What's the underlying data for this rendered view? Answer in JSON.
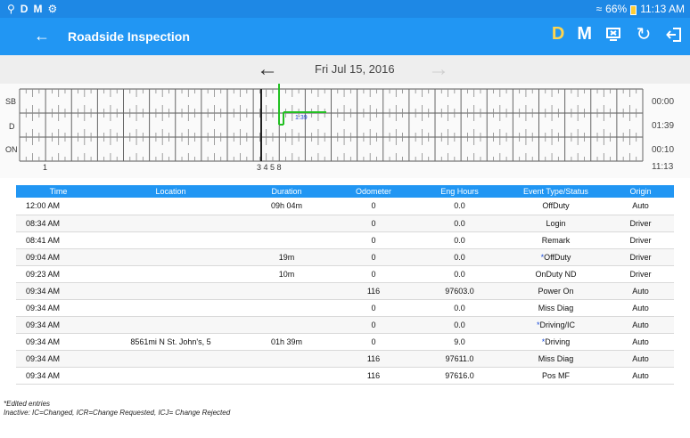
{
  "status_bar": {
    "left_icons": [
      "location-icon",
      "D",
      "M",
      "usb-icon"
    ],
    "battery": "66%",
    "time": "11:13 AM"
  },
  "app_bar": {
    "title": "Roadside Inspection",
    "actions": [
      {
        "label": "D",
        "color": "#ffd54f"
      },
      {
        "label": "M",
        "color": "#ffffff"
      }
    ]
  },
  "date_nav": {
    "date": "Fri Jul 15, 2016"
  },
  "graph": {
    "rows": [
      "SB",
      "D",
      "ON"
    ],
    "totals": [
      "00:00",
      "01:39",
      "00:10"
    ],
    "grand_total": "11:13",
    "start_hour_label": "1",
    "event_marker_label": "3 4 5 8",
    "segment_label": "1:39"
  },
  "table": {
    "headers": [
      "Time",
      "Location",
      "Duration",
      "Odometer",
      "Eng Hours",
      "Event Type/Status",
      "Origin"
    ],
    "rows": [
      {
        "time": "12:00 AM",
        "location": "",
        "duration": "09h 04m",
        "odometer": "0",
        "eng_hours": "0.0",
        "star": "",
        "event": "OffDuty",
        "origin": "Auto"
      },
      {
        "time": "08:34 AM",
        "location": "",
        "duration": "",
        "odometer": "0",
        "eng_hours": "0.0",
        "star": "",
        "event": "Login",
        "origin": "Driver"
      },
      {
        "time": "08:41 AM",
        "location": "",
        "duration": "",
        "odometer": "0",
        "eng_hours": "0.0",
        "star": "",
        "event": "Remark",
        "origin": "Driver"
      },
      {
        "time": "09:04 AM",
        "location": "",
        "duration": "19m",
        "odometer": "0",
        "eng_hours": "0.0",
        "star": "*",
        "event": "OffDuty",
        "origin": "Driver"
      },
      {
        "time": "09:23 AM",
        "location": "",
        "duration": "10m",
        "odometer": "0",
        "eng_hours": "0.0",
        "star": "",
        "event": "OnDuty ND",
        "origin": "Driver"
      },
      {
        "time": "09:34 AM",
        "location": "",
        "duration": "",
        "odometer": "116",
        "eng_hours": "97603.0",
        "star": "",
        "event": "Power On",
        "origin": "Auto"
      },
      {
        "time": "09:34 AM",
        "location": "",
        "duration": "",
        "odometer": "0",
        "eng_hours": "0.0",
        "star": "",
        "event": "Miss Diag",
        "origin": "Auto"
      },
      {
        "time": "09:34 AM",
        "location": "",
        "duration": "",
        "odometer": "0",
        "eng_hours": "0.0",
        "star": "*",
        "event": "Driving/IC",
        "origin": "Auto"
      },
      {
        "time": "09:34 AM",
        "location": "8561mi N St. John's, 5",
        "duration": "01h 39m",
        "odometer": "0",
        "eng_hours": "9.0",
        "star": "*",
        "event": "Driving",
        "origin": "Auto"
      },
      {
        "time": "09:34 AM",
        "location": "",
        "duration": "",
        "odometer": "116",
        "eng_hours": "97611.0",
        "star": "",
        "event": "Miss Diag",
        "origin": "Auto"
      },
      {
        "time": "09:34 AM",
        "location": "",
        "duration": "",
        "odometer": "116",
        "eng_hours": "97616.0",
        "star": "",
        "event": "Pos MF",
        "origin": "Auto"
      }
    ]
  },
  "notes": {
    "edited": "*Edited entries",
    "inactive": "Inactive: IC=Changed, ICR=Change Requested, ICJ= Change Rejected"
  }
}
